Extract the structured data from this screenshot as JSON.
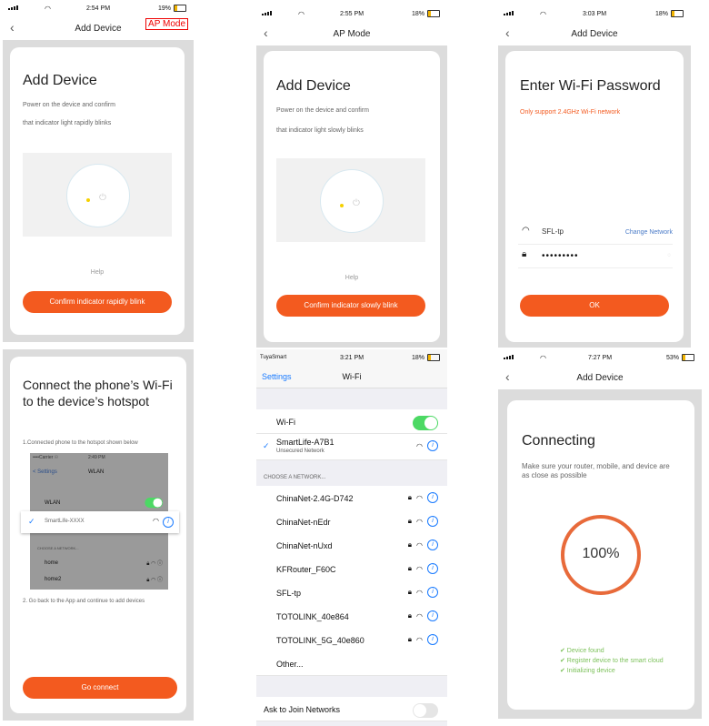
{
  "p1": {
    "time": "2:54 PM",
    "battery": "19%",
    "nav_title": "Add Device",
    "ap_mode": "AP Mode",
    "heading": "Add Device",
    "line1": "Power on the device and confirm",
    "line2": "that indicator light rapidly blinks",
    "help": "Help",
    "button": "Confirm indicator rapidly blink"
  },
  "p2": {
    "time": "2:55 PM",
    "battery": "18%",
    "nav_title": "AP Mode",
    "heading": "Add Device",
    "line1": "Power on the device and confirm",
    "line2": "that indicator light slowly blinks",
    "help": "Help",
    "button": "Confirm indicator slowly blink"
  },
  "p3": {
    "time": "3:03 PM",
    "battery": "18%",
    "nav_title": "Add Device",
    "heading": "Enter Wi-Fi Password",
    "note": "Only support 2.4GHz Wi-Fi network",
    "ssid": "SFL-tp",
    "change": "Change Network",
    "password": "•••••••••",
    "button": "OK",
    "accent": "#f35a1f"
  },
  "p4": {
    "heading": "Connect the phone’s Wi-Fi to the device’s hotspot",
    "step1": "1.Connected phone to the hotspot shown below",
    "inner": {
      "carrier": "••••Carrier ☉",
      "time": "2:49 PM",
      "back": "< Settings",
      "title": "WLAN",
      "wlan": "WLAN",
      "net": "SmartLife-XXXX",
      "choose": "CHOOSE A NETWORK...",
      "home": "home",
      "home2": "home2"
    },
    "step2": "2. Go back to the App and continue to add devices",
    "button": "Go connect"
  },
  "p5": {
    "carrier": "TuyaSmart",
    "time": "3:21 PM",
    "battery": "18%",
    "back": "Settings",
    "title": "Wi-Fi",
    "wifi_label": "Wi-Fi",
    "connected": "SmartLife-A7B1",
    "connected_sub": "Unsecured Network",
    "choose": "CHOOSE A NETWORK...",
    "networks": [
      "ChinaNet-2.4G-D742",
      "ChinaNet-nEdr",
      "ChinaNet-nUxd",
      "KFRouter_F60C",
      "SFL-tp",
      "TOTOLINK_40e864",
      "TOTOLINK_5G_40e860"
    ],
    "other": "Other...",
    "ask": "Ask to Join Networks"
  },
  "p6": {
    "time": "7:27 PM",
    "battery": "53%",
    "nav_title": "Add Device",
    "heading": "Connecting",
    "desc": "Make sure your router, mobile, and device are as close as possible",
    "progress": "100%",
    "progress_value": 1.0,
    "steps": [
      "✔ Device found",
      "✔ Register device to the smart cloud",
      "✔ Initializing device"
    ]
  }
}
